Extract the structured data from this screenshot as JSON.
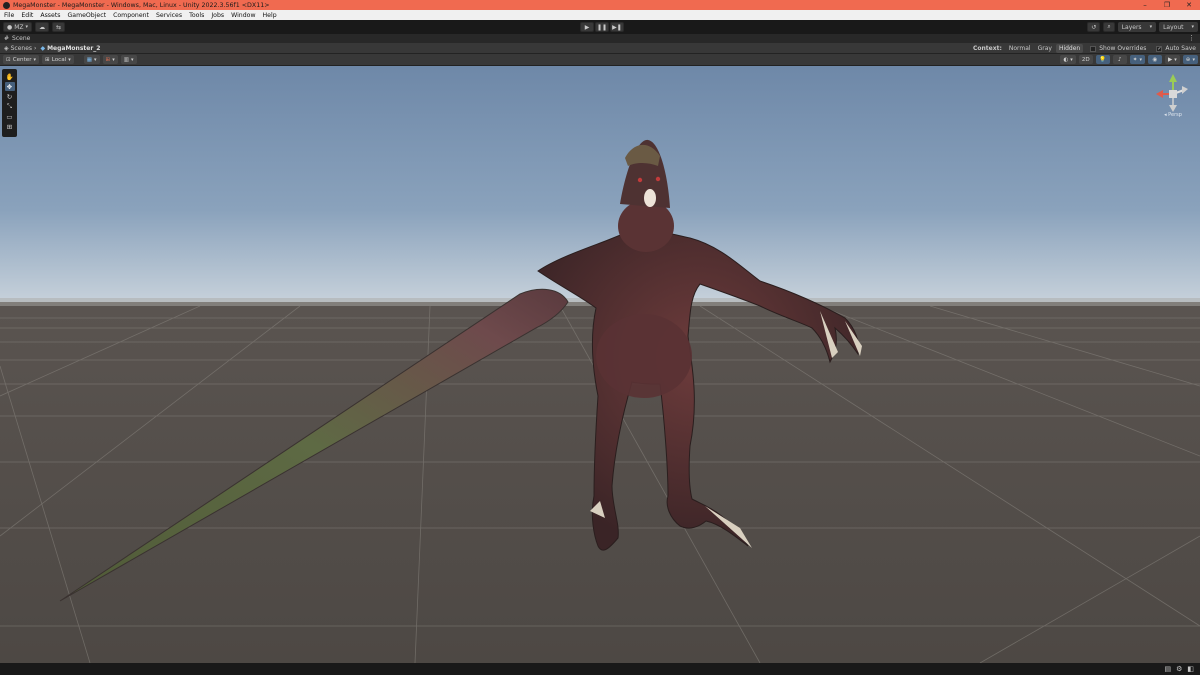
{
  "window": {
    "title": "MegaMonster - MegaMonster - Windows, Mac, Linux - Unity 2022.3.56f1 <DX11>",
    "controls": [
      "–",
      "❐",
      "✕"
    ]
  },
  "menu": [
    "File",
    "Edit",
    "Assets",
    "GameObject",
    "Component",
    "Services",
    "Tools",
    "Jobs",
    "Window",
    "Help"
  ],
  "toolbar": {
    "account": "MZ",
    "play": "▶",
    "pause": "❚❚",
    "step": "▶❚",
    "layers": "Layers",
    "layout": "Layout"
  },
  "scene_tab": {
    "label": "Scene",
    "menu": "⋮"
  },
  "breadcrumb": {
    "root": "Scenes",
    "current": "MegaMonster_2"
  },
  "context": {
    "label": "Context:",
    "options": [
      "Normal",
      "Gray",
      "Hidden"
    ],
    "active": "Hidden",
    "show_overrides": "Show Overrides",
    "auto_save": "Auto Save",
    "auto_save_checked": true
  },
  "scene_toolbar": {
    "pivot": "Center",
    "space": "Local",
    "mode_2d": "2D"
  },
  "gizmo": {
    "label": "◂ Persp"
  },
  "colors": {
    "title_bar": "#f06a50",
    "accent": "#46607c"
  }
}
